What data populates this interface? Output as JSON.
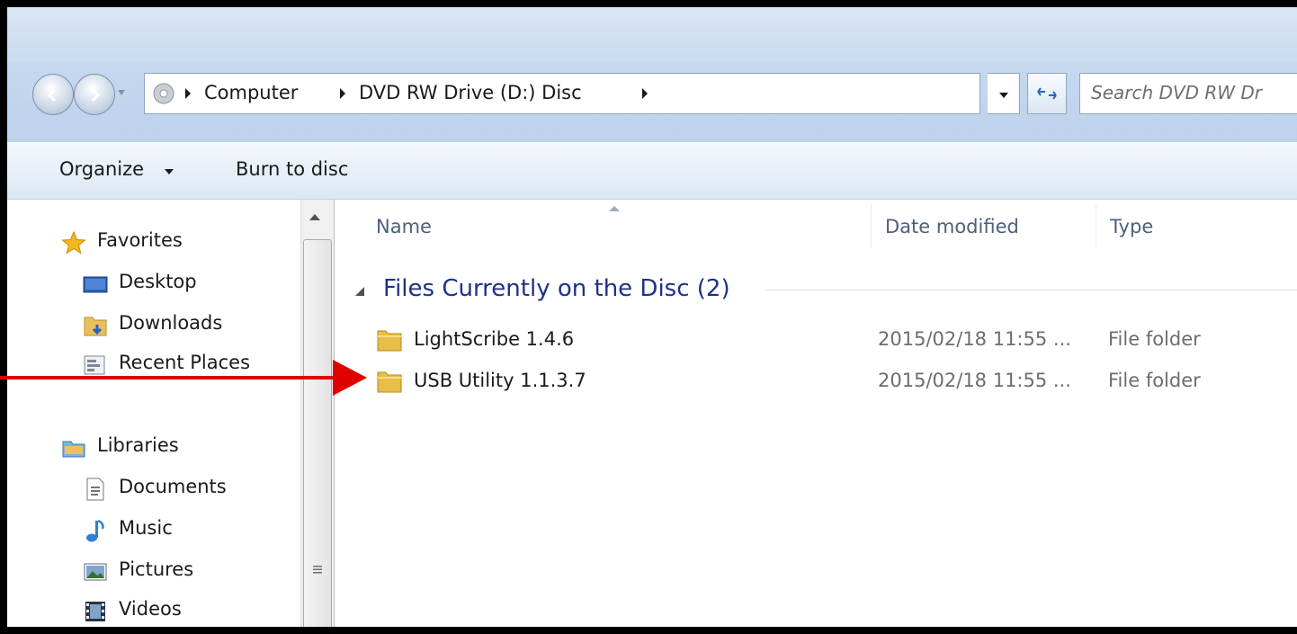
{
  "window": {
    "breadcrumbs": [
      "Computer",
      "DVD RW Drive (D:) Disc"
    ],
    "search_placeholder": "Search DVD RW Dr"
  },
  "toolbar": {
    "organize_label": "Organize",
    "burn_label": "Burn to disc"
  },
  "nav": {
    "favorites": {
      "label": "Favorites",
      "items": [
        {
          "label": "Desktop",
          "icon": "desktop-icon"
        },
        {
          "label": "Downloads",
          "icon": "downloads-folder-icon"
        },
        {
          "label": "Recent Places",
          "icon": "recent-places-icon"
        }
      ]
    },
    "libraries": {
      "label": "Libraries",
      "items": [
        {
          "label": "Documents",
          "icon": "documents-icon"
        },
        {
          "label": "Music",
          "icon": "music-icon"
        },
        {
          "label": "Pictures",
          "icon": "pictures-icon"
        },
        {
          "label": "Videos",
          "icon": "videos-icon"
        }
      ]
    }
  },
  "columns": {
    "name": "Name",
    "date_modified": "Date modified",
    "type": "Type"
  },
  "group": {
    "title": "Files Currently on the Disc (2)"
  },
  "files": [
    {
      "name": "LightScribe 1.4.6",
      "date": "2015/02/18 11:55 ...",
      "type": "File folder"
    },
    {
      "name": "USB Utility 1.1.3.7",
      "date": "2015/02/18 11:55 ...",
      "type": "File folder"
    }
  ],
  "colors": {
    "group_title": "#1e3287",
    "annotation_arrow": "#e00000",
    "column_header": "#4c607a"
  }
}
